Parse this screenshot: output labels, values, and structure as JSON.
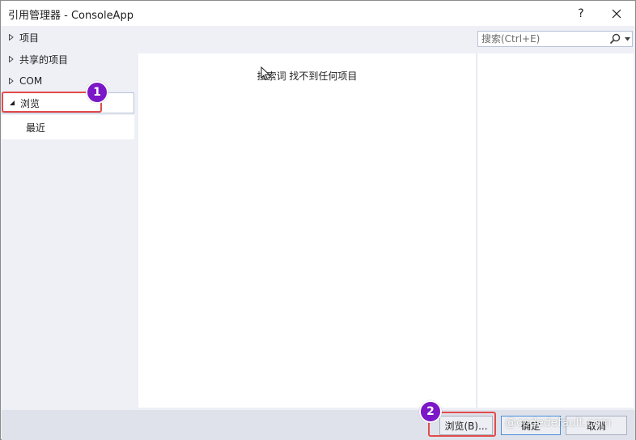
{
  "window": {
    "title": "引用管理器 - ConsoleApp",
    "help_label": "?"
  },
  "tree": {
    "items": [
      {
        "label": "项目",
        "expanded": false
      },
      {
        "label": "共享的项目",
        "expanded": false
      },
      {
        "label": "COM",
        "expanded": false
      },
      {
        "label": "浏览",
        "expanded": true,
        "selected": true
      }
    ],
    "children": [
      {
        "label": "最近"
      }
    ]
  },
  "main": {
    "empty_message": "搜索词  找不到任何项目"
  },
  "search": {
    "placeholder": "搜索(Ctrl+E)",
    "value": ""
  },
  "footer": {
    "browse_label": "浏览(B)...",
    "ok_label": "确定",
    "cancel_label": "取消"
  },
  "annotations": {
    "badge_1": "1",
    "badge_2": "2"
  },
  "watermark": "@codedefault.com",
  "colors": {
    "accent": "#7b17c7",
    "highlight": "#e24b4b",
    "pane_bg": "#eef0f6"
  }
}
